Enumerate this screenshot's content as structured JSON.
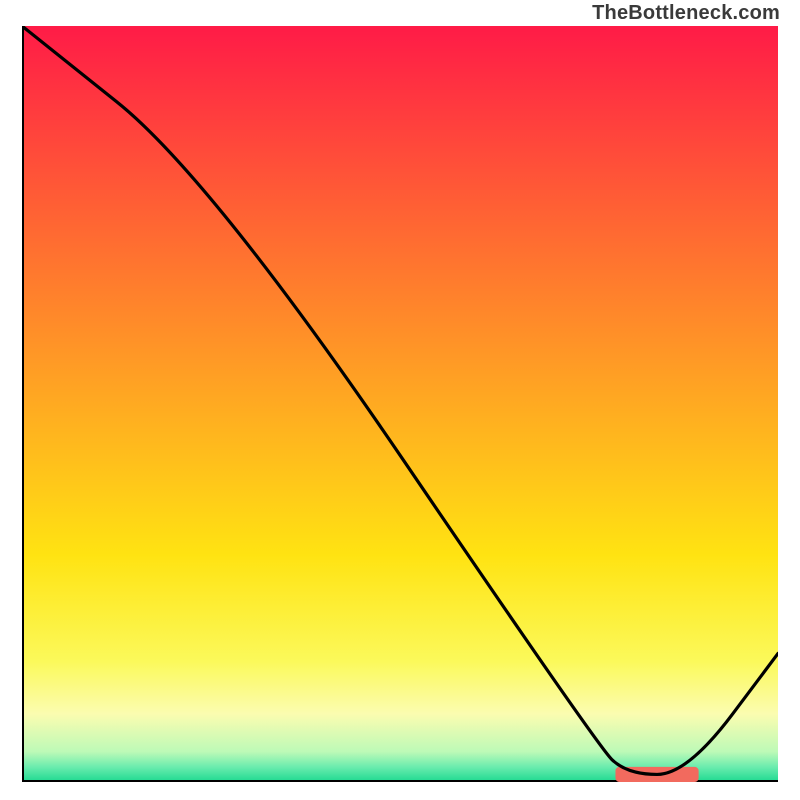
{
  "attribution": "TheBottleneck.com",
  "chart_data": {
    "type": "line",
    "title": "",
    "xlabel": "",
    "ylabel": "",
    "xlim": [
      0,
      100
    ],
    "ylim": [
      0,
      100
    ],
    "grid": false,
    "background_gradient_stops": [
      {
        "offset": 0,
        "color": "#ff1b47"
      },
      {
        "offset": 23,
        "color": "#ff5d35"
      },
      {
        "offset": 49,
        "color": "#ffa722"
      },
      {
        "offset": 70,
        "color": "#ffe312"
      },
      {
        "offset": 84,
        "color": "#fbf95a"
      },
      {
        "offset": 91,
        "color": "#fbfcb0"
      },
      {
        "offset": 96,
        "color": "#bdfab7"
      },
      {
        "offset": 98,
        "color": "#6becae"
      },
      {
        "offset": 100,
        "color": "#1dd990"
      }
    ],
    "series": [
      {
        "name": "bottleneck-curve",
        "color": "#000000",
        "points": [
          {
            "x": 0,
            "y": 100
          },
          {
            "x": 25,
            "y": 80
          },
          {
            "x": 76,
            "y": 5
          },
          {
            "x": 80,
            "y": 1
          },
          {
            "x": 88,
            "y": 1
          },
          {
            "x": 100,
            "y": 17
          }
        ]
      }
    ],
    "annotations": [
      {
        "name": "optimal-marker",
        "x": 84,
        "y": 1,
        "shape": "rounded-bar",
        "color": "#f26a5e",
        "width_pct": 11,
        "height_pct": 2
      }
    ]
  }
}
